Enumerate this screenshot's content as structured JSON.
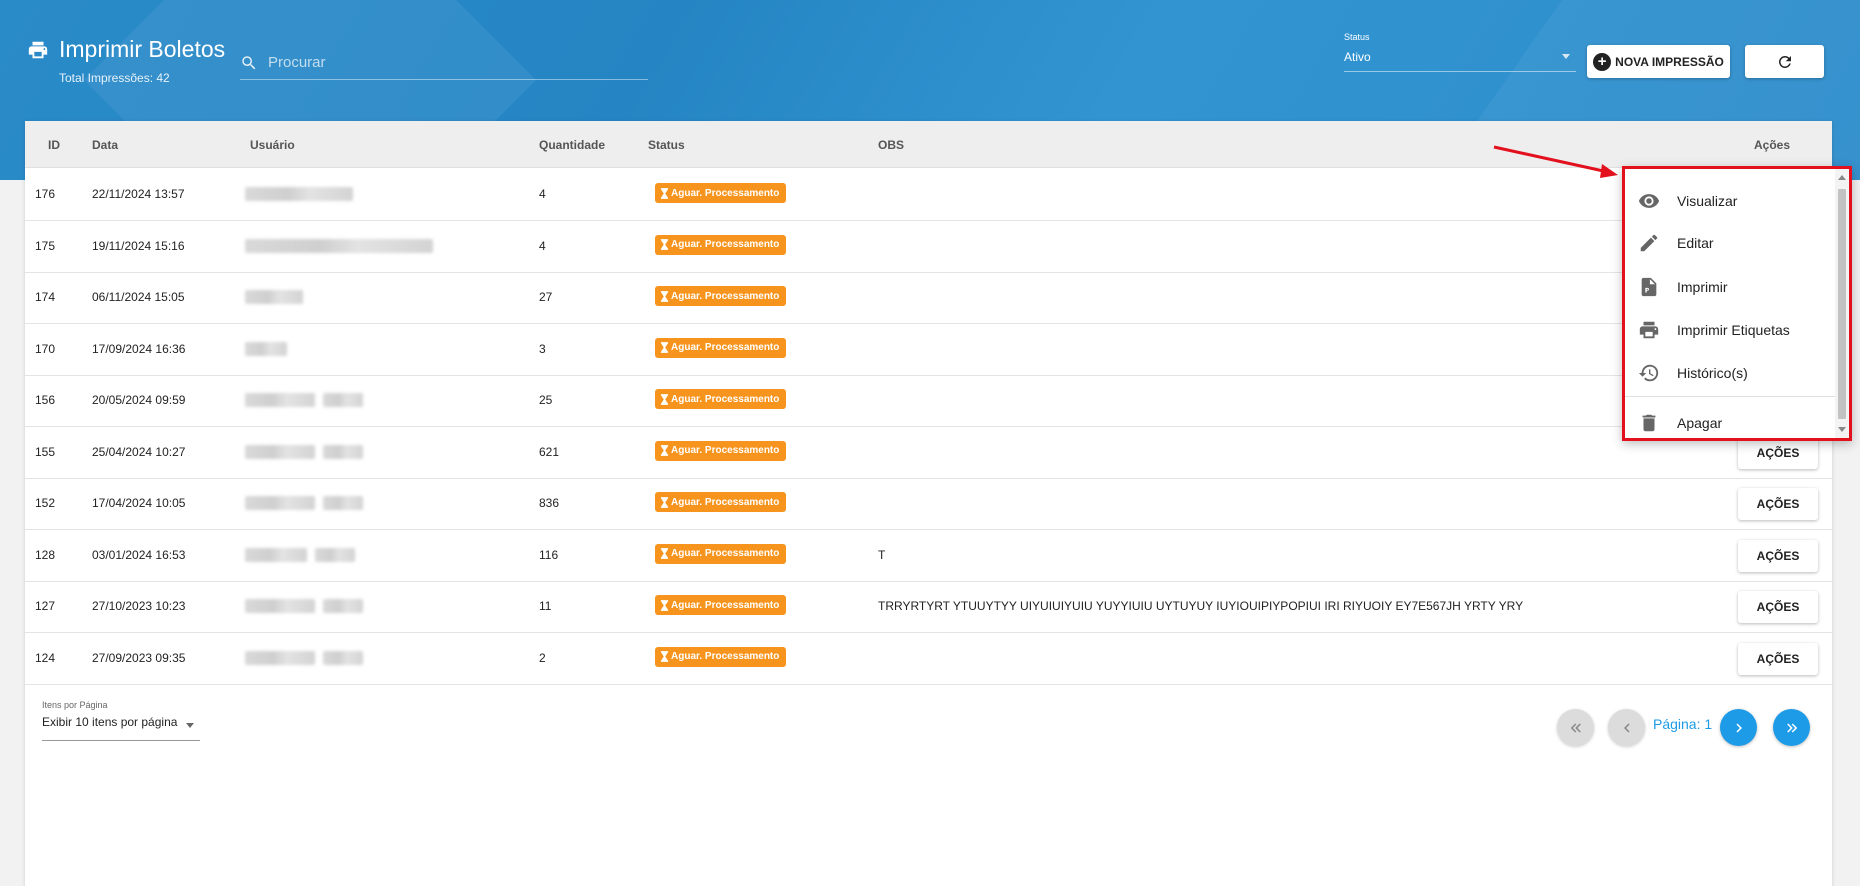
{
  "header": {
    "title": "Imprimir Boletos",
    "subtitle": "Total Impressões: 42",
    "search_placeholder": "Procurar",
    "status_label": "Status",
    "status_value": "Ativo",
    "new_button": "NOVA IMPRESSÃO"
  },
  "table": {
    "columns": [
      "ID",
      "Data",
      "Usuário",
      "Quantidade",
      "Status",
      "OBS",
      "Ações"
    ],
    "rows": [
      {
        "id": "176",
        "data": "22/11/2024 13:57",
        "quantidade": "4",
        "status": "Aguar. Processamento",
        "obs": ""
      },
      {
        "id": "175",
        "data": "19/11/2024 15:16",
        "quantidade": "4",
        "status": "Aguar. Processamento",
        "obs": ""
      },
      {
        "id": "174",
        "data": "06/11/2024 15:05",
        "quantidade": "27",
        "status": "Aguar. Processamento",
        "obs": ""
      },
      {
        "id": "170",
        "data": "17/09/2024 16:36",
        "quantidade": "3",
        "status": "Aguar. Processamento",
        "obs": ""
      },
      {
        "id": "156",
        "data": "20/05/2024 09:59",
        "quantidade": "25",
        "status": "Aguar. Processamento",
        "obs": ""
      },
      {
        "id": "155",
        "data": "25/04/2024 10:27",
        "quantidade": "621",
        "status": "Aguar. Processamento",
        "obs": "",
        "acoes": "AÇÕES"
      },
      {
        "id": "152",
        "data": "17/04/2024 10:05",
        "quantidade": "836",
        "status": "Aguar. Processamento",
        "obs": "",
        "acoes": "AÇÕES"
      },
      {
        "id": "128",
        "data": "03/01/2024 16:53",
        "quantidade": "116",
        "status": "Aguar. Processamento",
        "obs": "T",
        "acoes": "AÇÕES"
      },
      {
        "id": "127",
        "data": "27/10/2023 10:23",
        "quantidade": "11",
        "status": "Aguar. Processamento",
        "obs": "TRRYRTYRT YTUUYTYY UIYUIUIYUIU YUYYIUIU UYTUYUY IUYIOUIPIYPOPIUI IRI RIYUOIY EY7E567JH YRTY YRY",
        "acoes": "AÇÕES"
      },
      {
        "id": "124",
        "data": "27/09/2023 09:35",
        "quantidade": "2",
        "status": "Aguar. Processamento",
        "obs": "",
        "acoes": "AÇÕES"
      }
    ]
  },
  "pagination": {
    "items_label": "Itens por Página",
    "items_value": "Exibir 10 itens por página",
    "page_label": "Página: 1"
  },
  "menu": {
    "items": [
      "Visualizar",
      "Editar",
      "Imprimir",
      "Imprimir Etiquetas",
      "Histórico(s)",
      "Apagar"
    ]
  },
  "colors": {
    "banner": "#2a8bc9",
    "badge": "#f7941d",
    "page_active": "#1d9be6",
    "highlight": "#e3101e"
  }
}
